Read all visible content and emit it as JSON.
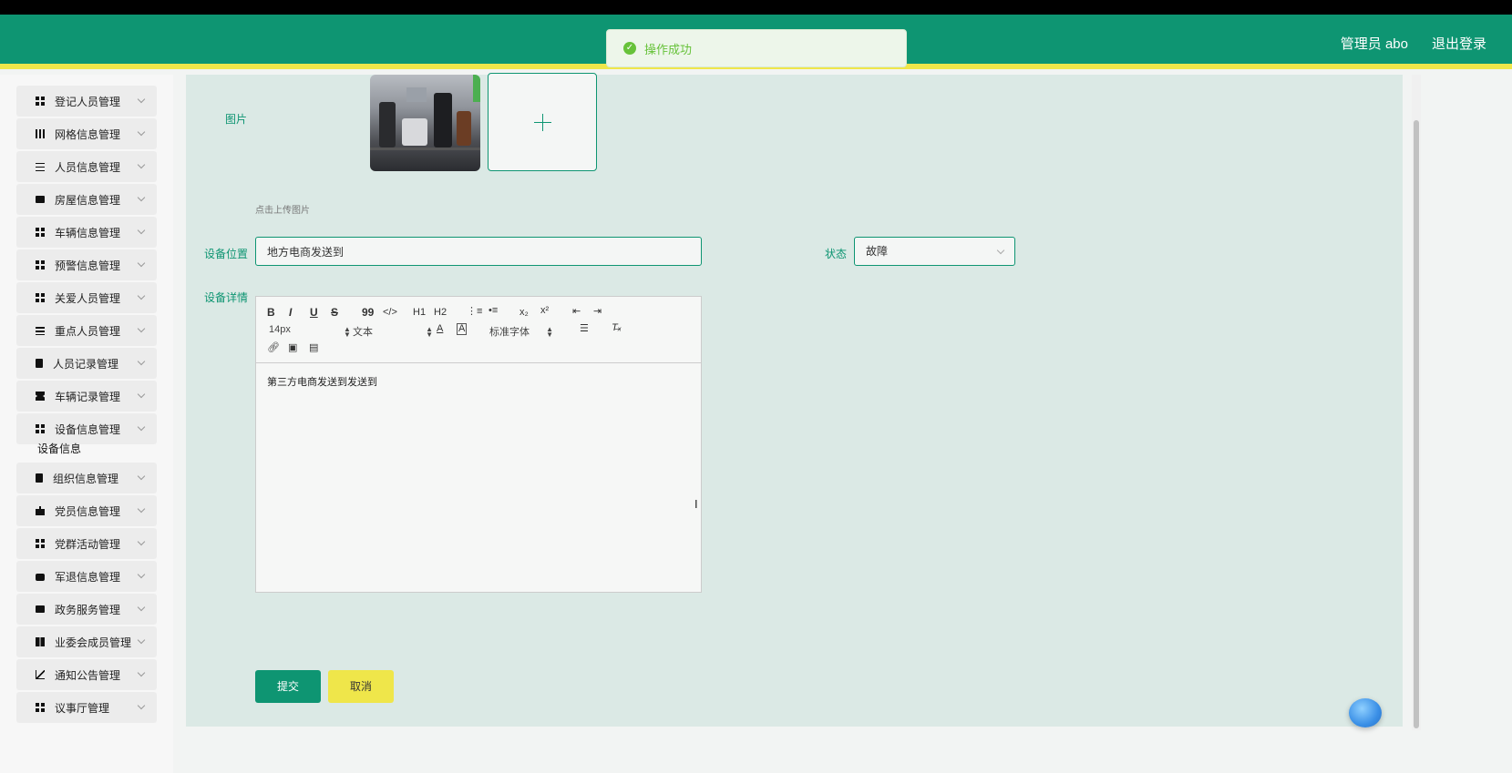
{
  "header": {
    "user_label": "管理员 abo",
    "logout_label": "退出登录",
    "bg_color": "#0e9572",
    "accent_color": "#efe64a"
  },
  "toast": {
    "message": "操作成功",
    "icon": "check-circle-icon"
  },
  "sidebar": {
    "items": [
      {
        "label": "登记人员管理",
        "icon": "grid-icon"
      },
      {
        "label": "网格信息管理",
        "icon": "grid-nine-icon"
      },
      {
        "label": "人员信息管理",
        "icon": "sliders-icon"
      },
      {
        "label": "房屋信息管理",
        "icon": "monitor-icon"
      },
      {
        "label": "车辆信息管理",
        "icon": "grid-icon"
      },
      {
        "label": "预警信息管理",
        "icon": "grid-icon"
      },
      {
        "label": "关爱人员管理",
        "icon": "grid-icon"
      },
      {
        "label": "重点人员管理",
        "icon": "list-icon"
      },
      {
        "label": "人员记录管理",
        "icon": "clipboard-icon"
      },
      {
        "label": "车辆记录管理",
        "icon": "ticket-icon"
      },
      {
        "label": "设备信息管理",
        "icon": "grid-icon"
      },
      {
        "label": "组织信息管理",
        "icon": "clipboard-icon"
      },
      {
        "label": "党员信息管理",
        "icon": "bag-icon"
      },
      {
        "label": "党群活动管理",
        "icon": "grid-icon"
      },
      {
        "label": "军退信息管理",
        "icon": "briefcase-icon"
      },
      {
        "label": "政务服务管理",
        "icon": "monitor-icon"
      },
      {
        "label": "业委会成员管理",
        "icon": "book-icon"
      },
      {
        "label": "通知公告管理",
        "icon": "chart-icon"
      },
      {
        "label": "议事厅管理",
        "icon": "grid-icon"
      }
    ],
    "active_sub": "设备信息"
  },
  "form": {
    "image_label": "图片",
    "upload_hint": "点击上传图片",
    "location_label": "设备位置",
    "location_value": "地方电商发送到",
    "status_label": "状态",
    "status_value": "故障",
    "details_label": "设备详情",
    "details_content": "第三方电商发送到发送到"
  },
  "editor_toolbar": {
    "font_size": "14px",
    "paragraph": "文本",
    "font_family": "标准字体",
    "buttons": [
      "B",
      "I",
      "U",
      "S",
      "99",
      "</>",
      "H1",
      "H2"
    ]
  },
  "buttons": {
    "submit": "提交",
    "cancel": "取消"
  }
}
